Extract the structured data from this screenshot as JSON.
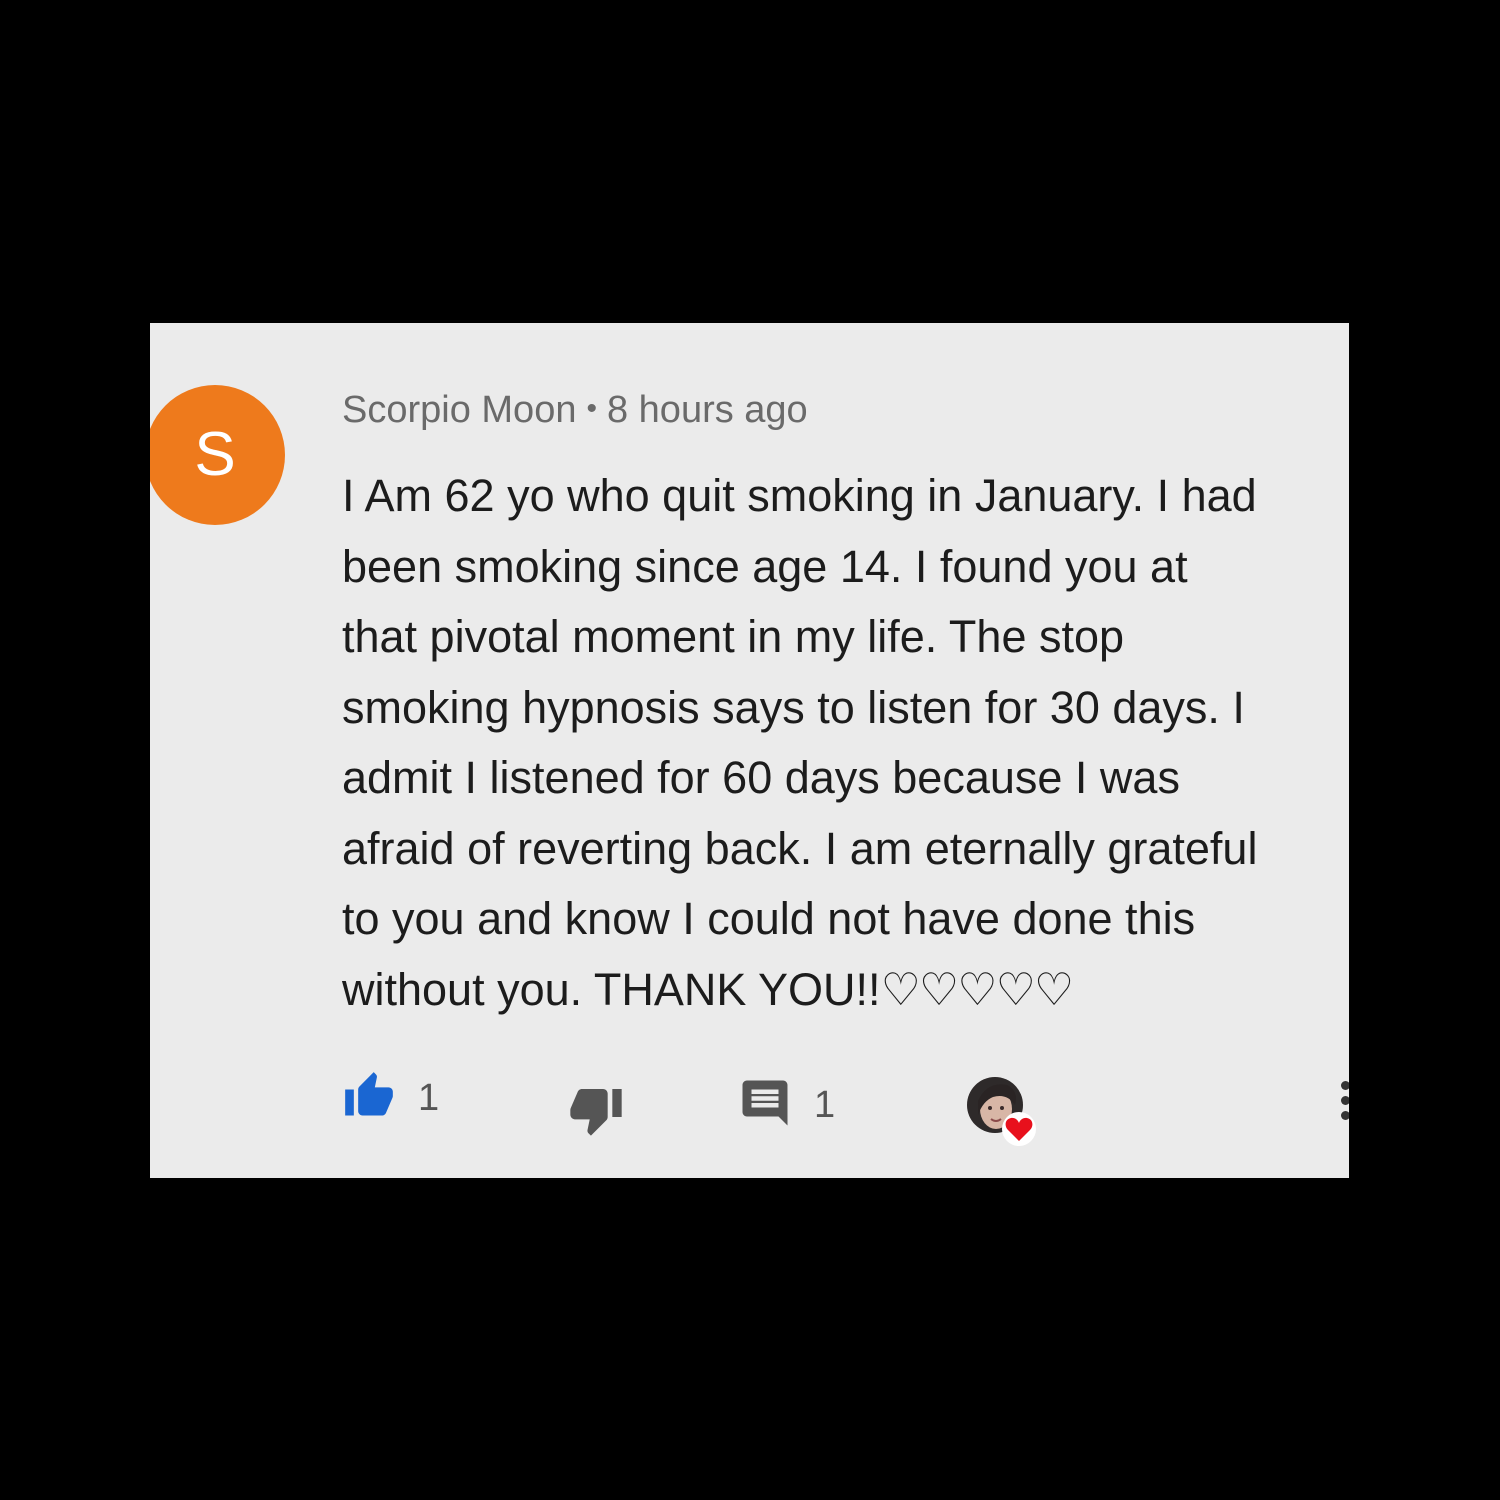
{
  "comment": {
    "avatar_letter": "S",
    "avatar_color": "#ee7a1c",
    "author": "Scorpio Moon",
    "separator": "•",
    "timestamp": "8 hours ago",
    "text_lines": [
      "I Am 62 yo who quit smoking in January. I had",
      "been smoking since age 14. I found you at",
      "that pivotal moment in my life. The stop",
      "smoking hypnosis says to listen for 30 days. I",
      "admit I listened for 60 days because I was",
      "afraid of reverting back. I am eternally grateful",
      "to you and know I could not have done this",
      "without you. THANK YOU!!"
    ],
    "trailing_hearts": "♡♡♡♡♡"
  },
  "actions": {
    "like_icon": "thumbs-up-icon",
    "like_count": "1",
    "like_color": "#1a66d2",
    "dislike_icon": "thumbs-down-icon",
    "reply_icon": "comment-icon",
    "reply_count": "1",
    "creator_heart_icon": "creator-heart-icon",
    "heart_color": "#e8101c",
    "menu_icon": "more-vertical-icon"
  }
}
